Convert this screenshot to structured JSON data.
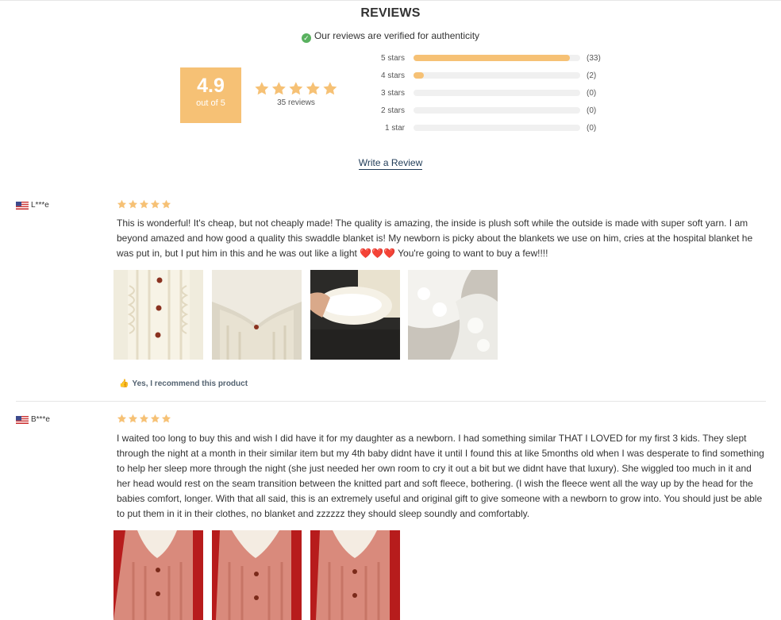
{
  "header": {
    "title": "REVIEWS",
    "verified_text": "Our reviews are verified for authenticity"
  },
  "summary": {
    "score": "4.9",
    "out_of": "out of 5",
    "stars": 5,
    "review_count": "35 reviews"
  },
  "breakdown": [
    {
      "label": "5 stars",
      "count": "(33)",
      "fraction": 0.94
    },
    {
      "label": "4 stars",
      "count": "(2)",
      "fraction": 0.06
    },
    {
      "label": "3 stars",
      "count": "(0)",
      "fraction": 0
    },
    {
      "label": "2 stars",
      "count": "(0)",
      "fraction": 0
    },
    {
      "label": "1 star",
      "count": "(0)",
      "fraction": 0
    }
  ],
  "write_review_label": "Write a Review",
  "reviews": [
    {
      "author": "L***e",
      "stars": 5,
      "text_before_hearts": "This is wonderful! It's cheap, but not cheaply made! The quality is amazing, the inside is plush soft while the outside is made with super soft yarn. I am beyond amazed and how good a quality this swaddle blanket is! My newborn is picky about the blankets we use on him, cries at the hospital blanket he was put in, but I put him in this and he was out like a light",
      "hearts": "❤️❤️❤️",
      "text_after_hearts": "You're going to want to buy a few!!!!",
      "recommend": "Yes, I recommend this product"
    },
    {
      "author": "B***e",
      "stars": 5,
      "text": "I waited too long to buy this and wish I did have it for my daughter as a newborn. I had something similar THAT I LOVED for my first 3 kids. They slept through the night at a month in their similar item but my 4th baby didnt have it until I found this at like 5months old when I was desperate to find something to help her sleep more through the night (she just needed her own room to cry it out a bit but we didnt have that luxury). She wiggled too much in it and her head would rest on the seam transition between the knitted part and soft fleece, bothering. (I wish the fleece went all the way up by the head for the babies comfort, longer. With that all said, this is an extremely useful and original gift to give someone with a newborn to grow into. You should just be able to put them in it in their clothes, no blanket and zzzzzz they should sleep soundly and comfortably."
    }
  ],
  "colors": {
    "star": "#f6c175",
    "score_box": "#f6c175",
    "link": "#1f3b57",
    "verified": "#59b15f"
  }
}
